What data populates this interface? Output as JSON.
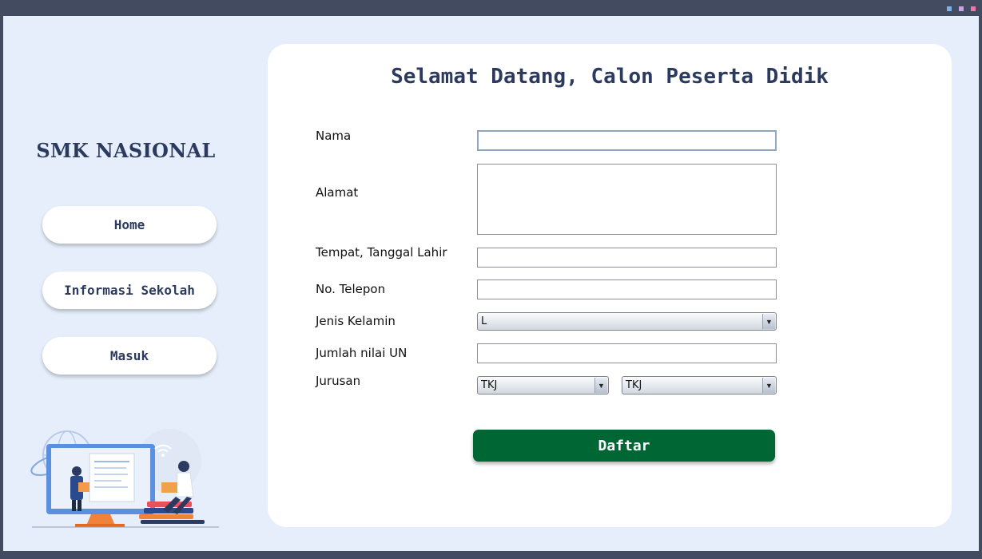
{
  "sidebar": {
    "brand": "SMK NASIONAL",
    "nav": [
      {
        "label": "Home"
      },
      {
        "label": "Informasi Sekolah"
      },
      {
        "label": "Masuk"
      }
    ]
  },
  "form": {
    "title": "Selamat Datang, Calon Peserta Didik",
    "labels": {
      "nama": "Nama",
      "alamat": "Alamat",
      "ttl": "Tempat, Tanggal Lahir",
      "telepon": "No. Telepon",
      "jenis_kelamin": "Jenis Kelamin",
      "nilai_un": "Jumlah nilai UN",
      "jurusan": "Jurusan"
    },
    "values": {
      "nama": "",
      "alamat": "",
      "ttl": "",
      "telepon": "",
      "nilai_un": ""
    },
    "jenis_kelamin_selected": "L",
    "jurusan_1_selected": "TKJ",
    "jurusan_2_selected": "TKJ",
    "submit_label": "Daftar"
  },
  "colors": {
    "accent": "#2b3a5e",
    "submit": "#006634",
    "background": "#e5eefa",
    "frame": "#434b60"
  }
}
